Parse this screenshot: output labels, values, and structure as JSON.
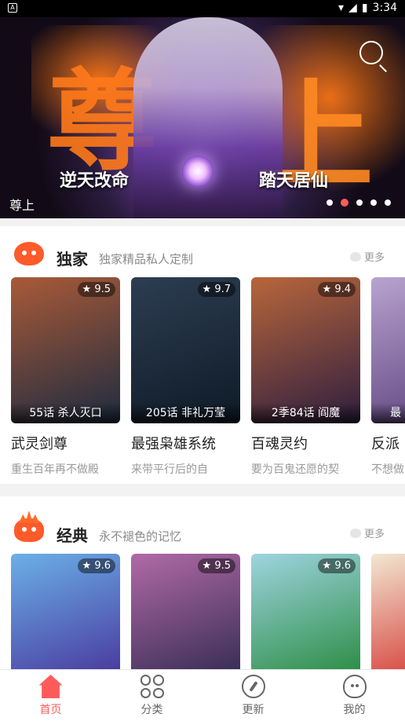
{
  "status_bar": {
    "time": "3:34"
  },
  "banner": {
    "art_title": "尊上",
    "phrase_left": "逆天改命",
    "phrase_right": "踏天居仙",
    "caption": "尊上",
    "pages": 5,
    "active_page": 2
  },
  "sections": [
    {
      "title": "独家",
      "subtitle": "独家精品私人定制",
      "more_label": "更多",
      "items": [
        {
          "title": "武灵剑尊",
          "desc": "重生百年再不做殿",
          "rating": "9.5",
          "chapter": "55话 杀人灭口",
          "cover_colors": [
            "#a95a38",
            "#1d2b40"
          ]
        },
        {
          "title": "最强枭雄系统",
          "desc": "来带平行后的自",
          "rating": "9.7",
          "chapter": "205话 非礼万莹",
          "cover_colors": [
            "#2d3d52",
            "#0e1a26"
          ]
        },
        {
          "title": "百魂灵约",
          "desc": "要为百鬼还愿的契",
          "rating": "9.4",
          "chapter": "2季84话 阎魔",
          "cover_colors": [
            "#b8663b",
            "#2e1e3f"
          ]
        },
        {
          "title": "反派",
          "desc": "不想做",
          "rating": "",
          "chapter": "最",
          "cover_colors": [
            "#b8a3d0",
            "#5a3f7a"
          ]
        }
      ]
    },
    {
      "title": "经典",
      "subtitle": "永不褪色的记忆",
      "more_label": "更多",
      "items": [
        {
          "rating": "9.6",
          "cover_colors": [
            "#6bb0e8",
            "#4a3ea0"
          ]
        },
        {
          "rating": "9.5",
          "cover_colors": [
            "#b16aa7",
            "#3b2f57"
          ]
        },
        {
          "rating": "9.6",
          "cover_colors": [
            "#9fd4e0",
            "#2e8f49"
          ]
        },
        {
          "rating": "",
          "cover_colors": [
            "#f1e8d4",
            "#d4322d"
          ]
        }
      ]
    }
  ],
  "bottom_nav": [
    {
      "label": "首页",
      "icon": "home-icon",
      "active": true
    },
    {
      "label": "分类",
      "icon": "category-icon",
      "active": false
    },
    {
      "label": "更新",
      "icon": "compass-icon",
      "active": false
    },
    {
      "label": "我的",
      "icon": "profile-icon",
      "active": false
    }
  ],
  "colors": {
    "accent": "#ff5b5b",
    "secondary_text": "#8a8a8a"
  }
}
